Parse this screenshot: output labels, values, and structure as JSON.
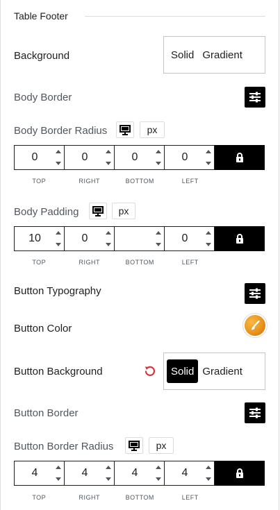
{
  "section": {
    "title": "Table Footer"
  },
  "background": {
    "label": "Background",
    "options": [
      "Solid",
      "Gradient"
    ]
  },
  "body_border": {
    "label": "Body Border"
  },
  "body_border_radius": {
    "label": "Body Border Radius",
    "unit": "px",
    "values": {
      "top": "0",
      "right": "0",
      "bottom": "0",
      "left": "0"
    }
  },
  "dim_labels": {
    "top": "TOP",
    "right": "RIGHT",
    "bottom": "BOTTOM",
    "left": "LEFT"
  },
  "body_padding": {
    "label": "Body Padding",
    "unit": "px",
    "values": {
      "top": "10",
      "right": "0",
      "bottom": "",
      "left": "0"
    }
  },
  "button_typography": {
    "label": "Button Typography"
  },
  "button_color": {
    "label": "Button Color"
  },
  "button_background": {
    "label": "Button Background",
    "options": [
      "Solid",
      "Gradient"
    ],
    "selected": "Solid"
  },
  "button_border": {
    "label": "Button Border"
  },
  "button_border_radius": {
    "label": "Button Border Radius",
    "unit": "px",
    "values": {
      "top": "4",
      "right": "4",
      "bottom": "4",
      "left": "4"
    }
  },
  "colors": {
    "accent_dark": "#000000",
    "reset_red": "#d63638",
    "border": "#c3c4c7",
    "color_swatch": "#e8901a"
  }
}
